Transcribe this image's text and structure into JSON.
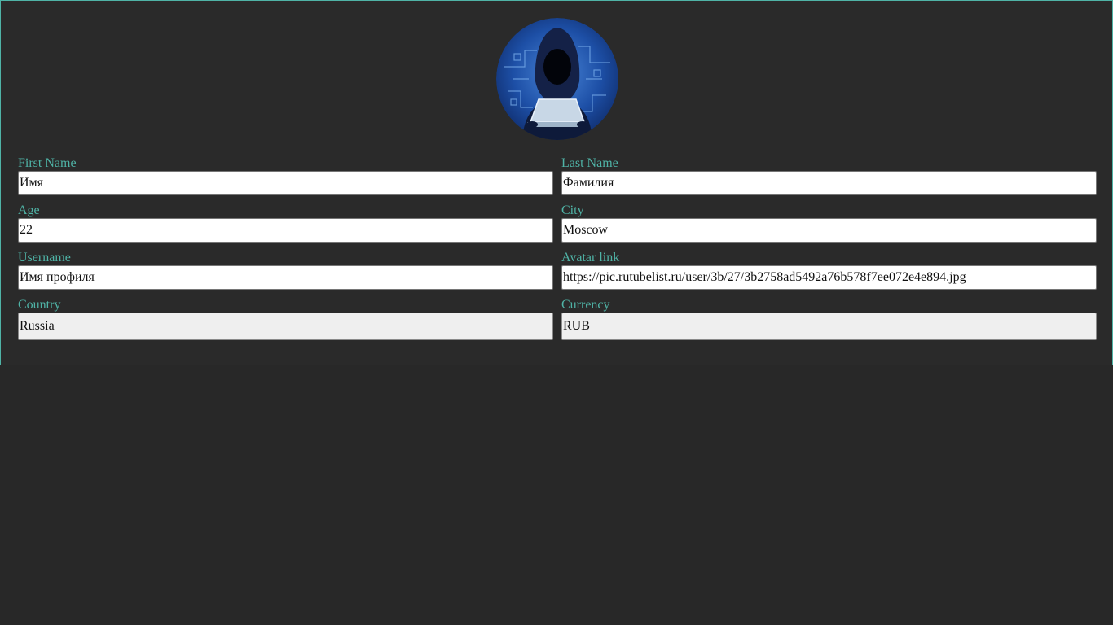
{
  "profile": {
    "avatar_icon": "hooded-hacker-avatar",
    "accent_color": "#4fb3a6",
    "fields": {
      "first_name": {
        "label": "First Name",
        "value": "Имя"
      },
      "last_name": {
        "label": "Last Name",
        "value": "Фамилия"
      },
      "age": {
        "label": "Age",
        "value": "22"
      },
      "city": {
        "label": "City",
        "value": "Moscow"
      },
      "username": {
        "label": "Username",
        "value": "Имя профиля"
      },
      "avatar_link": {
        "label": "Avatar link",
        "value": "https://pic.rutubelist.ru/user/3b/27/3b2758ad5492a76b578f7ee072e4e894.jpg"
      },
      "country": {
        "label": "Country",
        "value": "Russia"
      },
      "currency": {
        "label": "Currency",
        "value": "RUB"
      }
    }
  }
}
